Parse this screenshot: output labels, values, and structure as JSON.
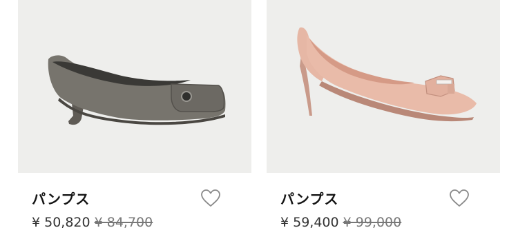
{
  "products": [
    {
      "name": "パンプス",
      "price": "¥ 50,820",
      "original_price": "¥ 84,700",
      "image_icon": "gray-low-heel-pump-image",
      "favorite_icon": "heart-outline-icon"
    },
    {
      "name": "パンプス",
      "price": "¥ 59,400",
      "original_price": "¥ 99,000",
      "image_icon": "pink-high-heel-pump-with-bow-image",
      "favorite_icon": "heart-outline-icon"
    }
  ],
  "colors": {
    "image_background": "#eeeeec",
    "text": "#151515",
    "original_price": "#777777"
  }
}
